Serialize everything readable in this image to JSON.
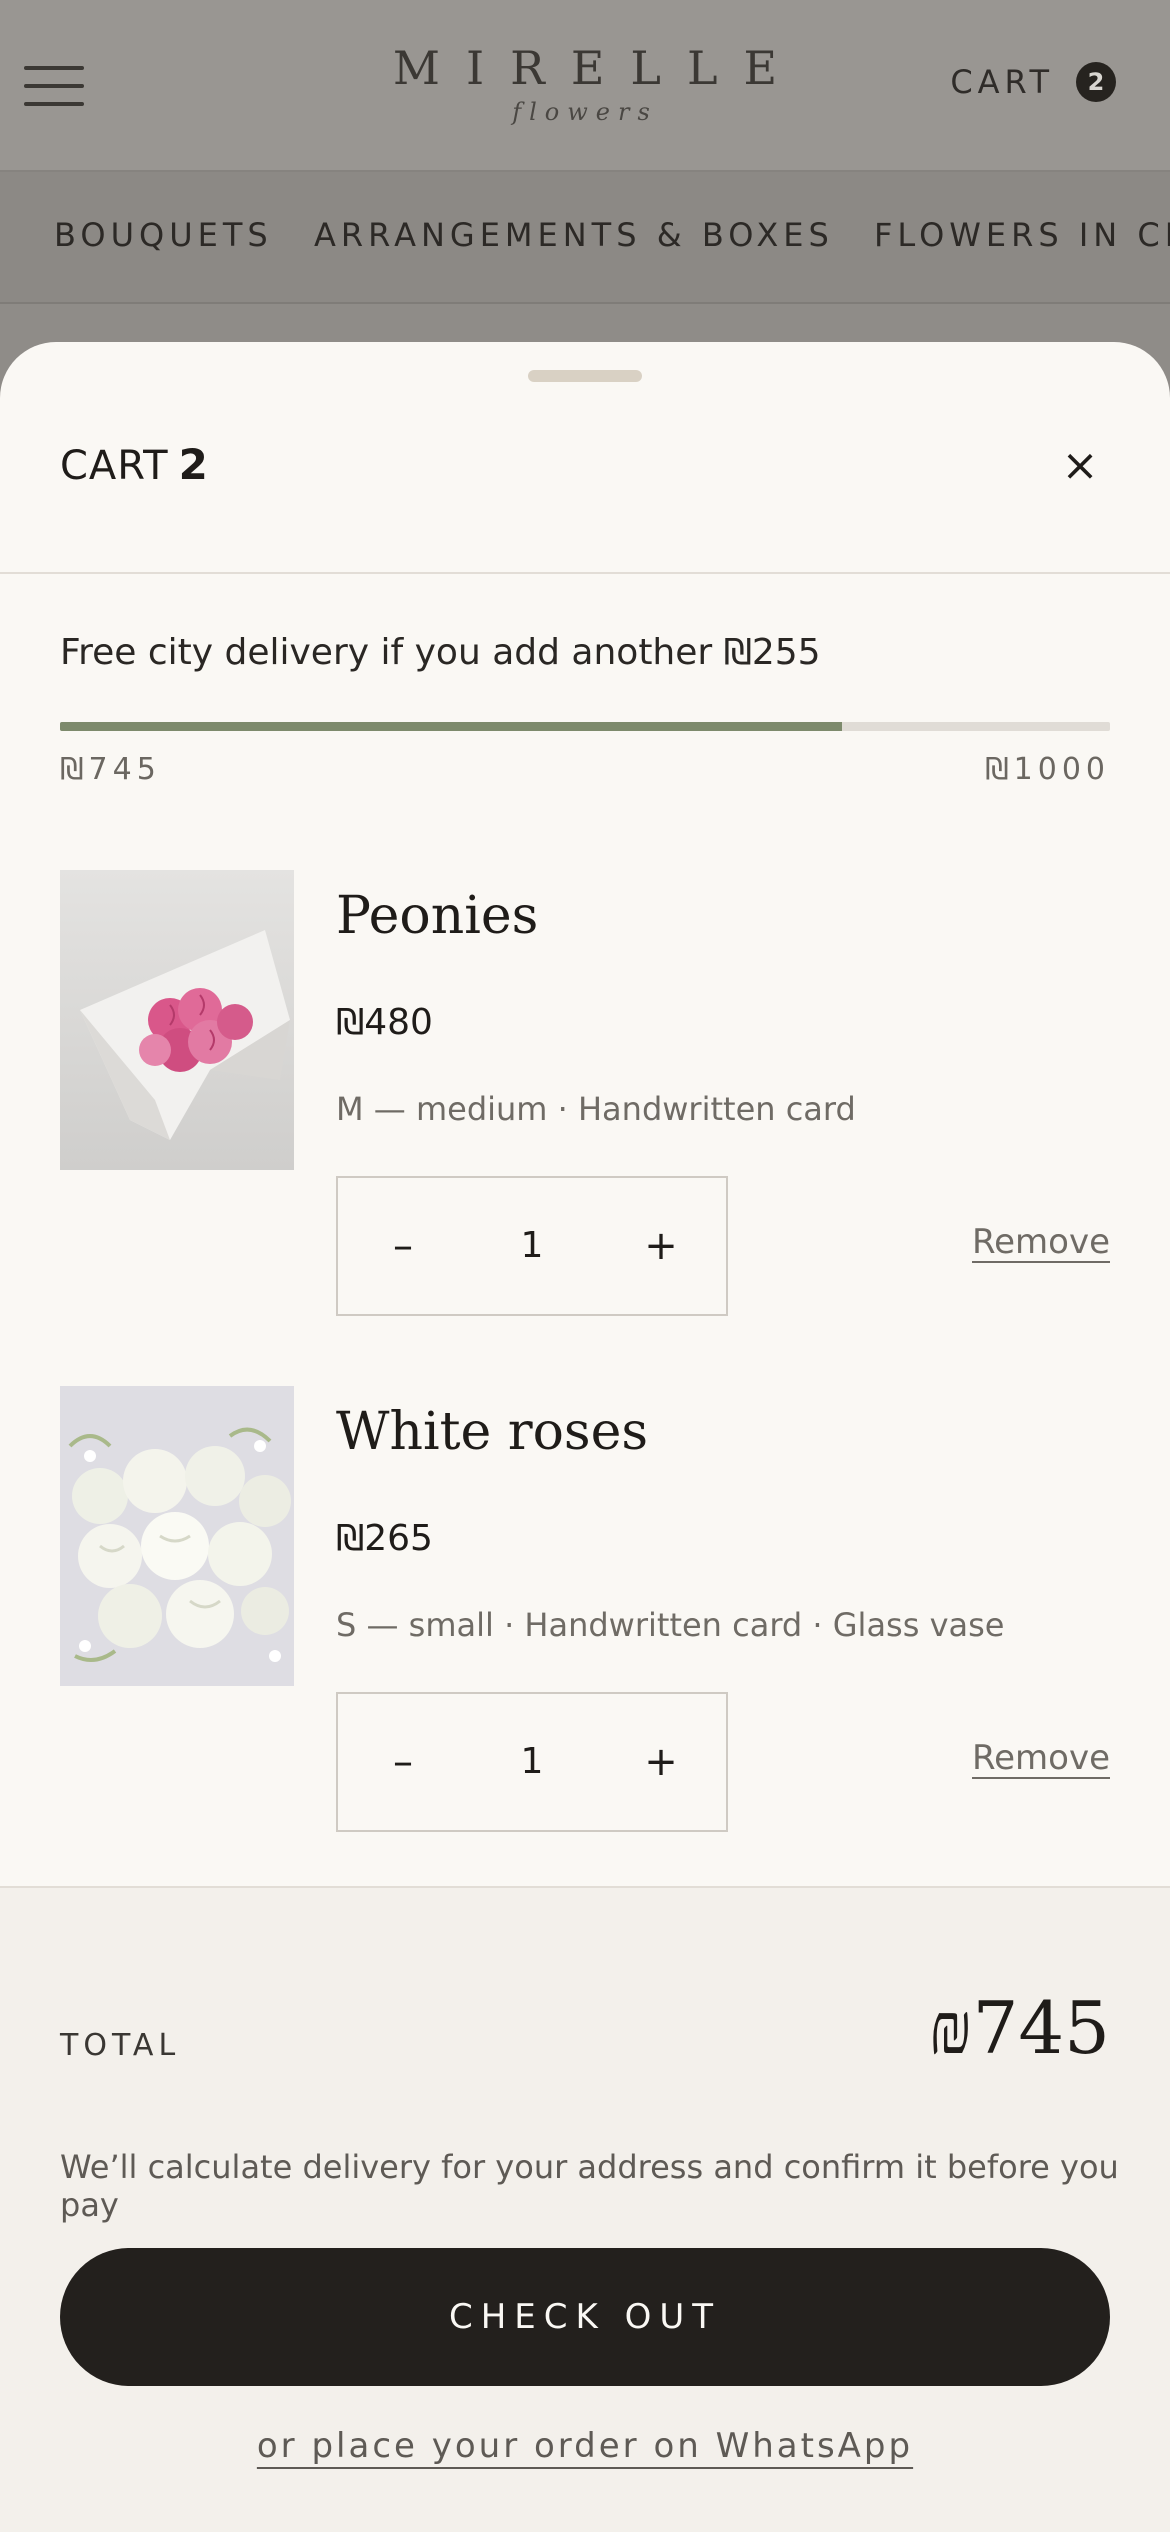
{
  "header": {
    "logo_main": "MIRELLE",
    "logo_sub": "flowers",
    "cart_label": "CART",
    "cart_count": "2"
  },
  "categories": [
    {
      "label": "BOUQUETS"
    },
    {
      "label": "ARRANGEMENTS & BOXES"
    },
    {
      "label": "FLOWERS IN CE"
    }
  ],
  "cart": {
    "title": "CART",
    "count": "2",
    "close_icon": "×",
    "delivery_message": "Free city delivery if you add another ₪255",
    "progress": {
      "current": 745,
      "goal": 1000,
      "current_label": "₪745",
      "goal_label": "₪1000",
      "fill_color": "#7d8a6c"
    },
    "items": [
      {
        "name": "Peonies",
        "price": "₪480",
        "options": "M — medium · Handwritten card",
        "quantity": "1",
        "minus": "–",
        "plus": "+",
        "remove": "Remove",
        "image": "pink-peony-bouquet"
      },
      {
        "name": "White roses",
        "price": "₪265",
        "options": "S — small · Handwritten card · Glass vase",
        "quantity": "1",
        "minus": "–",
        "plus": "+",
        "remove": "Remove",
        "image": "white-rose-bouquet"
      }
    ],
    "total_label": "TOTAL",
    "total_amount": "₪745",
    "delivery_note": "We’ll calculate delivery for your address and confirm it before you pay",
    "checkout_label": "CHECK OUT",
    "whatsapp_label": "or place your order on WhatsApp"
  }
}
